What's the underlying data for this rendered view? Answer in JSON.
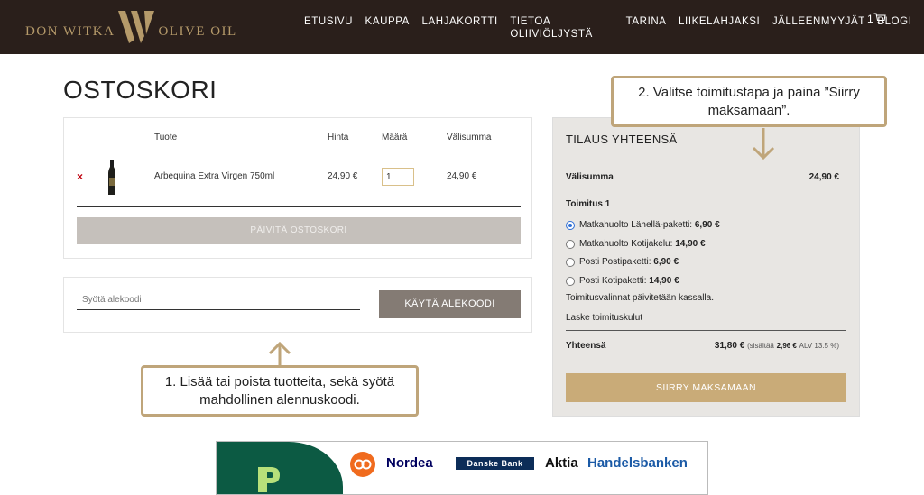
{
  "brand": {
    "left": "DON WITKA",
    "right": "OLIVE OIL",
    "mark": "W"
  },
  "nav": [
    "ETUSIVU",
    "KAUPPA",
    "LAHJAKORTTI",
    "TIETOA OLIIVIÖLJYSTÄ",
    "TARINA",
    "LIIKELAHJAKSI",
    "JÄLLEENMYYJÄT",
    "BLOGI"
  ],
  "cart": {
    "count": "1"
  },
  "page": {
    "title": "OSTOSKORI"
  },
  "table": {
    "headers": {
      "product": "Tuote",
      "price": "Hinta",
      "qty": "Määrä",
      "subtotal": "Välisumma"
    },
    "rows": [
      {
        "remove": "×",
        "product": "Arbequina Extra Virgen 750ml",
        "price": "24,90 €",
        "qty": "1",
        "subtotal": "24,90 €"
      }
    ],
    "update_label": "PÄIVITÄ OSTOSKORI"
  },
  "coupon": {
    "placeholder": "Syötä alekoodi",
    "apply_label": "KÄYTÄ ALEKOODI"
  },
  "totals": {
    "title": "TILAUS YHTEENSÄ",
    "subtotal_label": "Välisumma",
    "subtotal_value": "24,90 €",
    "shipping_label": "Toimitus 1",
    "options": [
      {
        "label": "Matkahuolto Lähellä-paketti:",
        "price": "6,90 €",
        "selected": true
      },
      {
        "label": "Matkahuolto Kotijakelu:",
        "price": "14,90 €",
        "selected": false
      },
      {
        "label": "Posti Postipaketti:",
        "price": "6,90 €",
        "selected": false
      },
      {
        "label": "Posti Kotipaketti:",
        "price": "14,90 €",
        "selected": false
      }
    ],
    "shipping_note": "Toimitusvalinnat päivitetään kassalla.",
    "calc_shipping": "Laske toimituskulut",
    "total_label": "Yhteensä",
    "total_value": "31,80 €",
    "tax_pre": "(sisältää",
    "tax_value": "2,96 €",
    "tax_post": "ALV 13.5 %)",
    "checkout_label": "SIIRRY MAKSAMAAN"
  },
  "callouts": {
    "step1": "1.  Lisää tai poista tuotteita, sekä syötä mahdollinen alennuskoodi.",
    "step2": "2. Valitse toimitustapa ja paina ”Siirry maksamaan”."
  },
  "banks": [
    "Nordea",
    "Danske Bank",
    "Aktia",
    "Handelsbanken"
  ],
  "colors": {
    "header": "#2a1f1b",
    "gold": "#bfa57a",
    "checkout": "#c9ab78",
    "apply": "#847b74",
    "remove": "#c0000e"
  }
}
